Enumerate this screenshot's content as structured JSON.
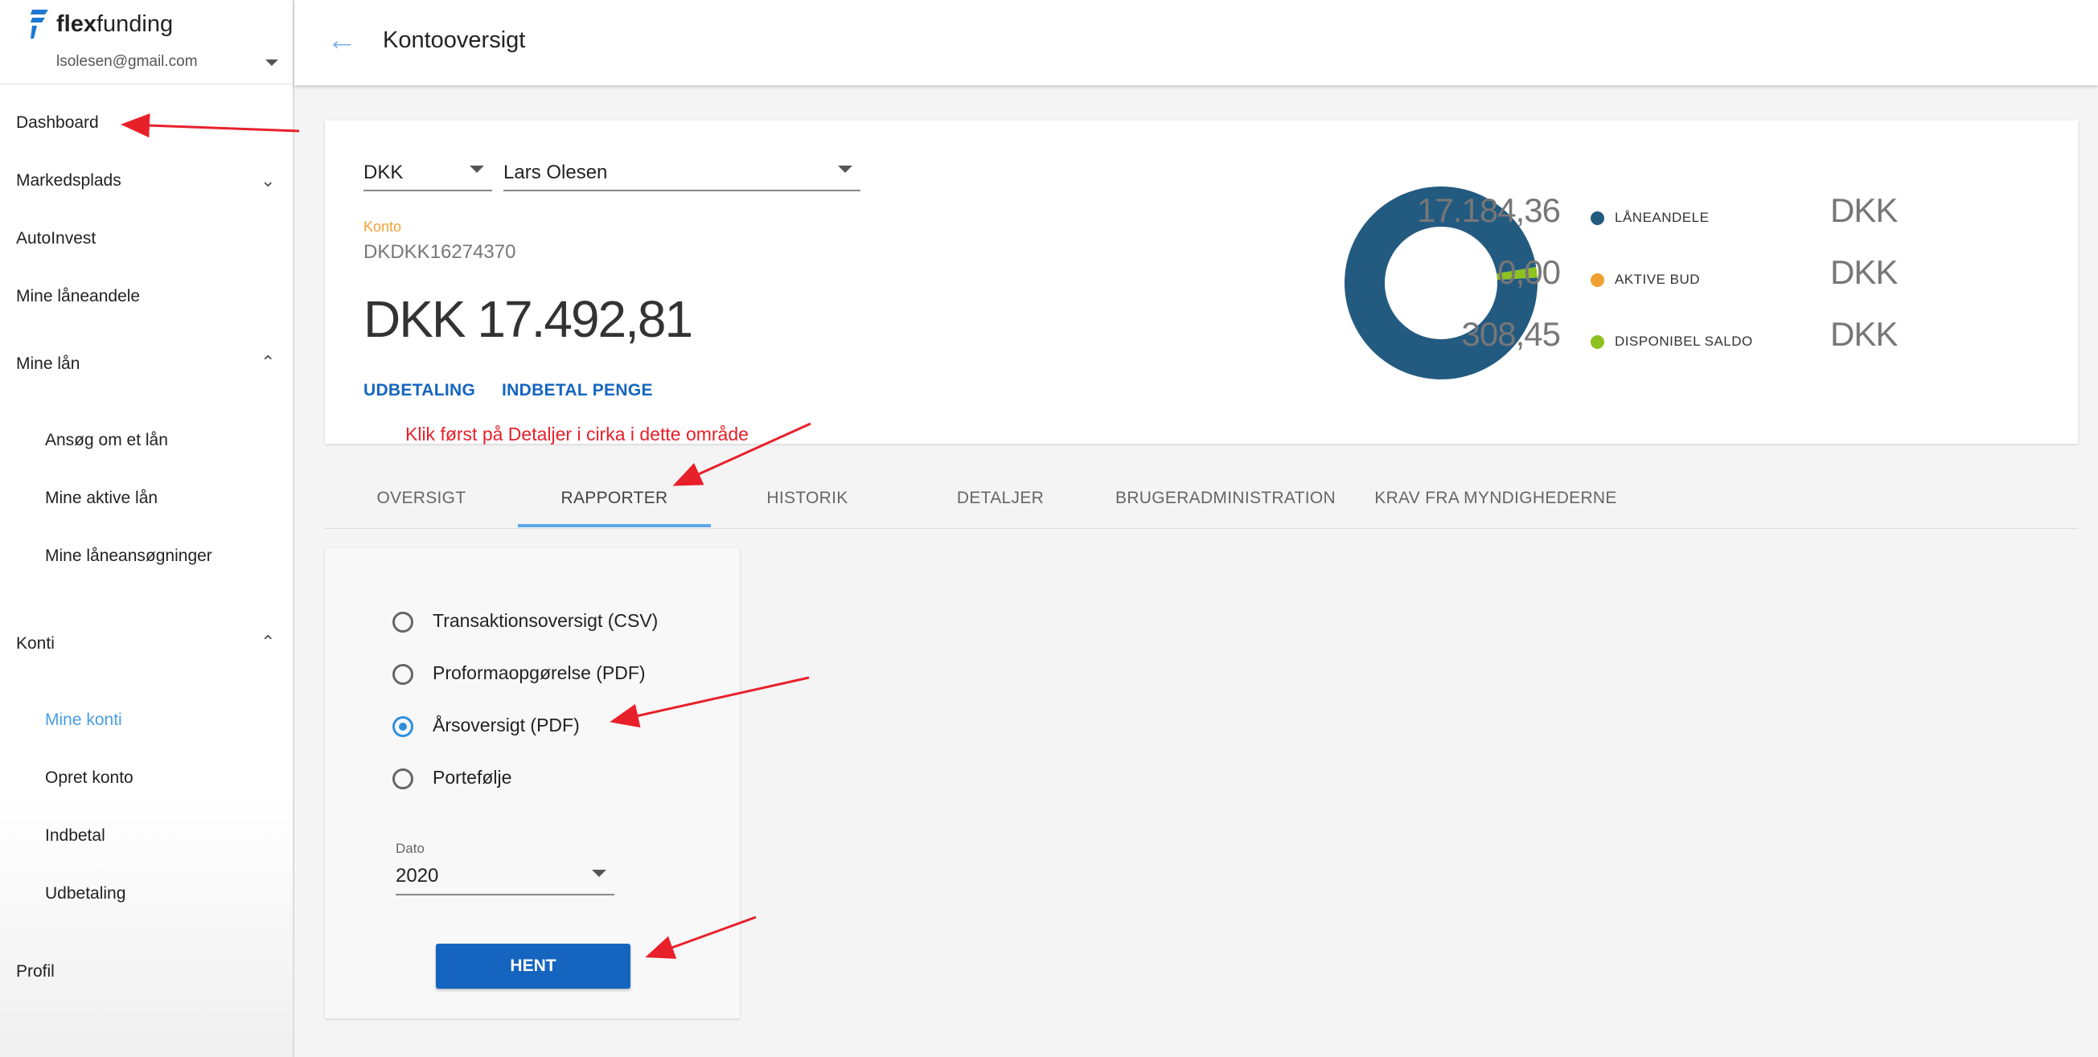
{
  "brand": {
    "name_bold": "flex",
    "name_rest": "funding"
  },
  "user": {
    "email": "lsolesen@gmail.com"
  },
  "sidebar": {
    "items": [
      {
        "label": "Dashboard"
      },
      {
        "label": "Markedsplads"
      },
      {
        "label": "AutoInvest"
      },
      {
        "label": "Mine låneandele"
      },
      {
        "label": "Mine lån"
      },
      {
        "label": "Ansøg om et lån"
      },
      {
        "label": "Mine aktive lån"
      },
      {
        "label": "Mine låneansøgninger"
      },
      {
        "label": "Konti"
      },
      {
        "label": "Mine konti"
      },
      {
        "label": "Opret konto"
      },
      {
        "label": "Indbetal"
      },
      {
        "label": "Udbetaling"
      },
      {
        "label": "Profil"
      }
    ]
  },
  "header": {
    "title": "Kontooversigt"
  },
  "account": {
    "currency": "DKK",
    "owner": "Lars Olesen",
    "konto_label": "Konto",
    "konto_number": "DKDKK16274370",
    "total_balance": "DKK 17.492,81",
    "actions": {
      "payout": "UDBETALING",
      "deposit": "INDBETAL PENGE"
    }
  },
  "chart_data": {
    "type": "pie",
    "categories": [
      "LÅNEANDELE",
      "AKTIVE BUD",
      "DISPONIBEL SALDO"
    ],
    "values": [
      17184.36,
      0.0,
      308.45
    ],
    "display_values": [
      "17.184,36",
      "0,00",
      "308,45"
    ],
    "currency": "DKK",
    "colors": [
      "#235a80",
      "#f0a030",
      "#8dc21f"
    ]
  },
  "annotation": {
    "text": "Klik først på Detaljer i cirka i dette område"
  },
  "tabs": [
    {
      "label": "OVERSIGT"
    },
    {
      "label": "RAPPORTER",
      "active": true
    },
    {
      "label": "HISTORIK"
    },
    {
      "label": "DETALJER"
    },
    {
      "label": "BRUGERADMINISTRATION"
    },
    {
      "label": "KRAV FRA MYNDIGHEDERNE"
    }
  ],
  "report": {
    "options": [
      {
        "label": "Transaktionsoversigt (CSV)",
        "checked": false
      },
      {
        "label": "Proformaopgørelse (PDF)",
        "checked": false
      },
      {
        "label": "Årsoversigt (PDF)",
        "checked": true
      },
      {
        "label": "Portefølje",
        "checked": false
      }
    ],
    "date_label": "Dato",
    "date_value": "2020",
    "submit_label": "HENT"
  },
  "colors": {
    "primary": "#1565c0",
    "accent_tab": "#5aa7e8",
    "active_nav": "#4a9de0",
    "annotation": "#e8202a"
  }
}
